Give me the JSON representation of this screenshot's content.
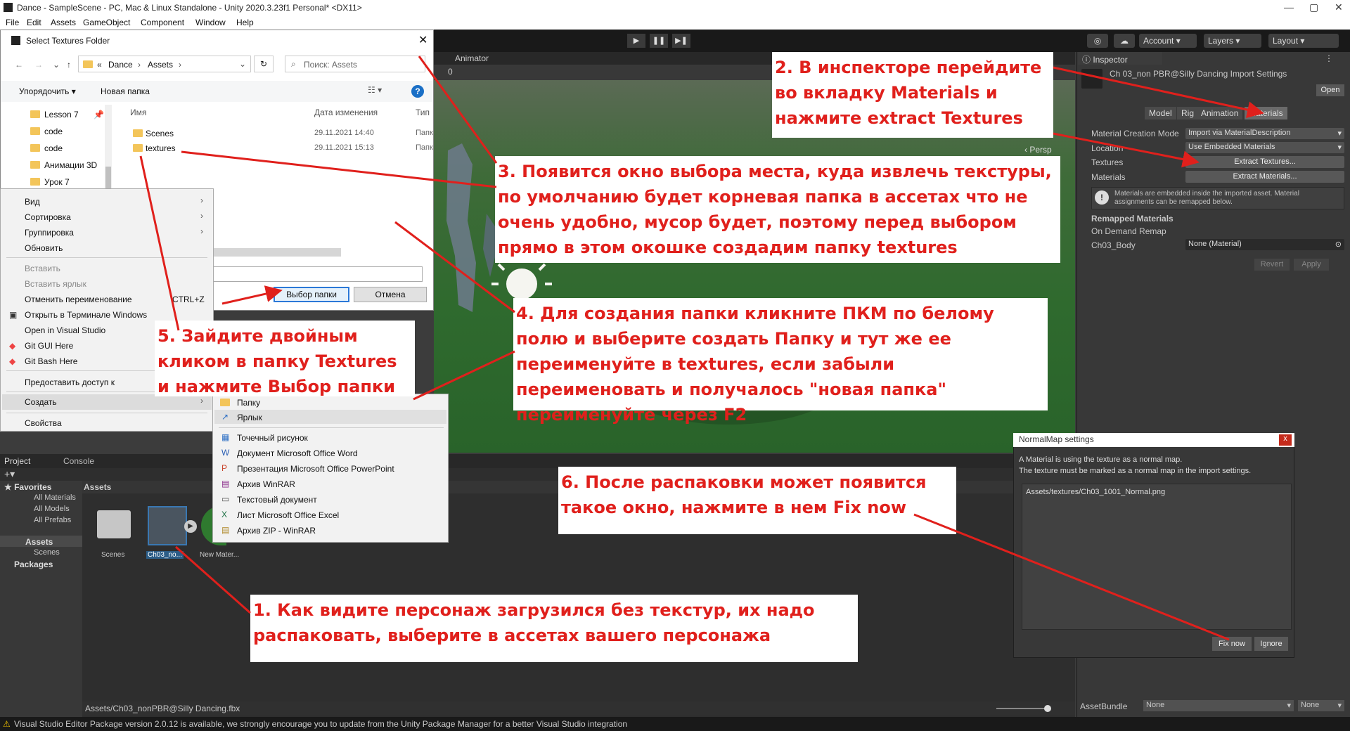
{
  "window": {
    "title": "Dance - SampleScene - PC, Mac & Linux Standalone - Unity 2020.3.23f1 Personal* <DX11>",
    "minimize": "—",
    "maximize": "▢",
    "close": "✕"
  },
  "menu": [
    "File",
    "Edit",
    "Assets",
    "GameObject",
    "Component",
    "Window",
    "Help"
  ],
  "toolbar": {
    "account": "Account",
    "layers": "Layers",
    "layout": "Layout",
    "play": "▶",
    "pause": "❚❚",
    "step": "▶❚"
  },
  "scene": {
    "tab_animator": "Animator",
    "persp": "‹ Persp",
    "gizmo_count": "0"
  },
  "inspector": {
    "tab": "Inspector",
    "asset_title": "Ch 03_non PBR@Silly Dancing Import Settings",
    "open": "Open",
    "tabs": [
      "Model",
      "Rig",
      "Animation",
      "Materials"
    ],
    "material_creation_mode_label": "Material Creation Mode",
    "material_creation_mode_value": "Import via MaterialDescription",
    "location_label": "Location",
    "location_value": "Use Embedded Materials",
    "textures_label": "Textures",
    "textures_button": "Extract Textures...",
    "materials_label": "Materials",
    "materials_button": "Extract Materials...",
    "info": "Materials are embedded inside the imported asset. Material assignments can be remapped below.",
    "remapped_header": "Remapped Materials",
    "on_demand": "On Demand Remap",
    "body_label": "Ch03_Body",
    "body_value": "None (Material)",
    "revert": "Revert",
    "apply": "Apply",
    "assetbundle_label": "AssetBundle",
    "assetbundle_value": "None",
    "assetbundle_variant": "None"
  },
  "project": {
    "tab_project": "Project",
    "tab_console": "Console",
    "favorites": "Favorites",
    "fav_items": [
      "All Materials",
      "All Models",
      "All Prefabs"
    ],
    "assets_root": "Assets",
    "assets_children": [
      "Scenes"
    ],
    "packages": "Packages",
    "path": "Assets",
    "items": [
      "Scenes",
      "Ch03_no...",
      "New Mater..."
    ],
    "selected_path": "Assets/Ch03_nonPBR@Silly Dancing.fbx"
  },
  "status": "Visual Studio Editor Package version 2.0.12 is available, we strongly encourage you to update from the Unity Package Manager for a better Visual Studio integration",
  "dialog": {
    "title": "Select Textures Folder",
    "breadcrumb": [
      "«",
      "Dance",
      "›",
      "Assets",
      "›"
    ],
    "search_placeholder": "Поиск: Assets",
    "organize": "Упорядочить ▾",
    "new_folder": "Новая папка",
    "col_name": "Имя",
    "col_date": "Дата изменения",
    "col_type": "Тип",
    "files": [
      {
        "name": "Scenes",
        "date": "29.11.2021 14:40",
        "type": "Папк"
      },
      {
        "name": "textures",
        "date": "29.11.2021 15:13",
        "type": "Папк"
      }
    ],
    "tree": [
      "Lesson 7",
      "code",
      "code",
      "Анимации 3D",
      "Урок 7"
    ],
    "select_button": "Выбор папки",
    "cancel_button": "Отмена",
    "help": "?"
  },
  "context_menu": {
    "items": [
      "Вид",
      "Сортировка",
      "Группировка",
      "Обновить",
      "Вставить",
      "Вставить ярлык",
      "Отменить переименование",
      "Открыть в Терминале Windows",
      "Open in Visual Studio",
      "Git GUI Here",
      "Git Bash Here",
      "Предоставить доступ к",
      "Создать",
      "Свойства"
    ],
    "undo_shortcut": "CTRL+Z"
  },
  "submenu": {
    "items": [
      "Папку",
      "Ярлык",
      "Точечный рисунок",
      "Документ Microsoft Office Word",
      "Презентация Microsoft Office PowerPoint",
      "Архив WinRAR",
      "Текстовый документ",
      "Лист Microsoft Office Excel",
      "Архив ZIP - WinRAR"
    ]
  },
  "normalmap": {
    "title": "NormalMap settings",
    "message": "A Material is using the texture as a normal map.\nThe texture must be marked as a normal map in the import settings.",
    "path": "Assets/textures/Ch03_1001_Normal.png",
    "fix": "Fix now",
    "ignore": "Ignore",
    "close": "x"
  },
  "annotations": {
    "n1": "1. Как видите персонаж загрузился без текстур, их надо распаковать, выберите в ассетах вашего персонажа",
    "n2": "2. В инспекторе перейдите во вкладку Materials и нажмите extract Textures",
    "n3": "3. Появится окно выбора места, куда извлечь текстуры, по умолчанию будет корневая папка в ассетах что не очень удобно, мусор будет, поэтому перед выбором прямо в этом окошке создадим папку textures",
    "n4": "4. Для создания папки кликните ПКМ по белому полю и выберите создать Папку и тут же ее переименуйте в textures, если забыли переименовать и получалось \"новая папка\" переименуйте через F2",
    "n5": "5. Зайдите двойным кликом в папку Textures и нажмите Выбор папки",
    "n6": "6. После распаковки может появится такое окно, нажмите в нем Fix now"
  },
  "colors": {
    "annotation": "#e0201c",
    "unity_dark": "#383838",
    "selection": "#2c5d87"
  }
}
